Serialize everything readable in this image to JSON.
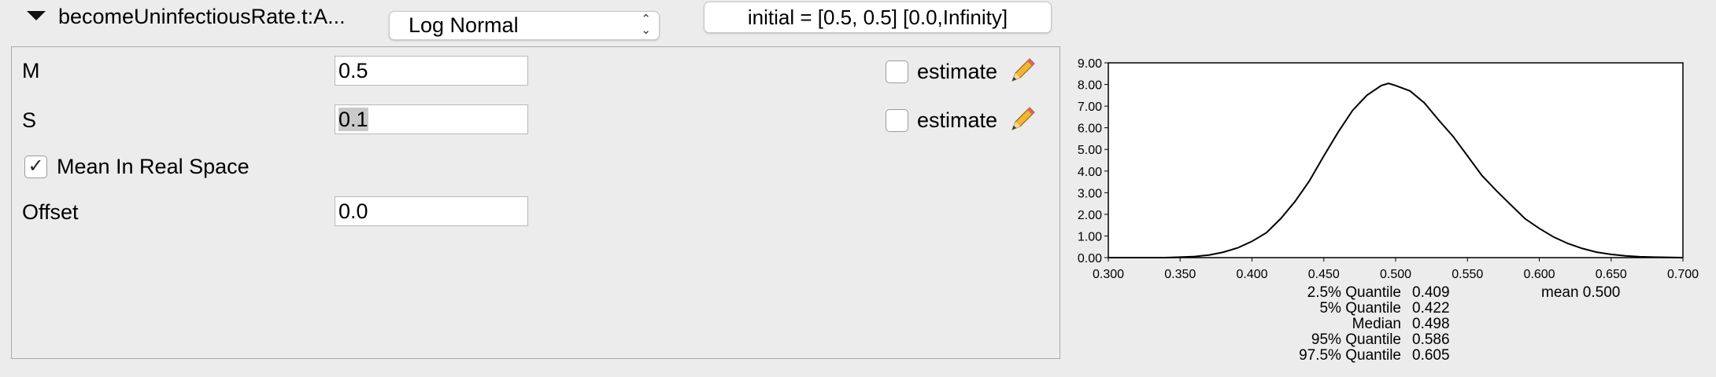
{
  "header": {
    "param_title": "becomeUninfectiousRate.t:A...",
    "distribution": "Log Normal",
    "initial_button": "initial = [0.5, 0.5] [0.0,Infinity]"
  },
  "params": {
    "m_label": "M",
    "m_value": "0.5",
    "s_label": "S",
    "s_value": "0.1",
    "estimate_label": "estimate",
    "mean_real_space_label": "Mean In Real Space",
    "mean_real_space_checked": true,
    "offset_label": "Offset",
    "offset_value": "0.0"
  },
  "chart_data": {
    "type": "line",
    "xlim": [
      0.3,
      0.7
    ],
    "ylim": [
      0,
      9
    ],
    "x_ticks": [
      "0.300",
      "0.350",
      "0.400",
      "0.450",
      "0.500",
      "0.550",
      "0.600",
      "0.650",
      "0.700"
    ],
    "y_ticks": [
      "0.00",
      "1.00",
      "2.00",
      "3.00",
      "4.00",
      "5.00",
      "6.00",
      "7.00",
      "8.00",
      "9.00"
    ],
    "grid": false,
    "series": [
      {
        "x": [
          0.3,
          0.34,
          0.35,
          0.36,
          0.37,
          0.38,
          0.39,
          0.4,
          0.41,
          0.42,
          0.43,
          0.44,
          0.45,
          0.46,
          0.47,
          0.48,
          0.49,
          0.495,
          0.5,
          0.51,
          0.52,
          0.53,
          0.54,
          0.55,
          0.56,
          0.57,
          0.58,
          0.59,
          0.6,
          0.61,
          0.62,
          0.63,
          0.64,
          0.65,
          0.66,
          0.67,
          0.68,
          0.7
        ],
        "y": [
          0.0,
          0.0,
          0.02,
          0.05,
          0.12,
          0.25,
          0.45,
          0.75,
          1.15,
          1.8,
          2.6,
          3.55,
          4.7,
          5.8,
          6.8,
          7.5,
          7.95,
          8.05,
          7.95,
          7.7,
          7.15,
          6.35,
          5.6,
          4.7,
          3.8,
          3.1,
          2.45,
          1.8,
          1.35,
          0.95,
          0.65,
          0.42,
          0.25,
          0.15,
          0.08,
          0.04,
          0.02,
          0.0
        ]
      }
    ]
  },
  "stats": {
    "rows": [
      {
        "name": "2.5% Quantile",
        "value": "0.409"
      },
      {
        "name": "5% Quantile",
        "value": "0.422"
      },
      {
        "name": "Median",
        "value": "0.498"
      },
      {
        "name": "95% Quantile",
        "value": "0.586"
      },
      {
        "name": "97.5% Quantile",
        "value": "0.605"
      }
    ],
    "mean": "mean 0.500"
  }
}
